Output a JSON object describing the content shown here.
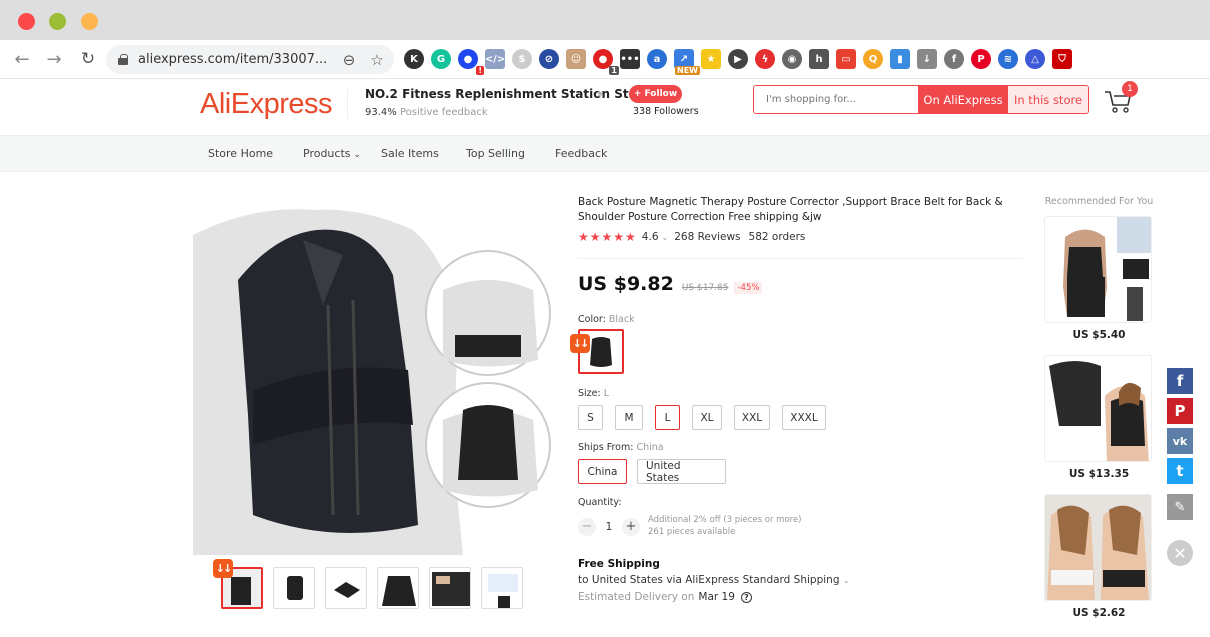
{
  "browser": {
    "url": "aliexpress.com/item/33007...",
    "window_dots": [
      "#fc4a4a",
      "#9bbd36",
      "#ffb54f"
    ],
    "extensions": [
      {
        "name": "k-extension",
        "glyph": "K",
        "color": "#333",
        "badge": ""
      },
      {
        "name": "grammarly",
        "glyph": "G",
        "color": "#15c39a",
        "badge": ""
      },
      {
        "name": "blue-circle-ext",
        "glyph": "●",
        "color": "#2046f0",
        "badge": "!"
      },
      {
        "name": "code-ext",
        "glyph": "</>",
        "color": "#8fa1c4",
        "badge": ""
      },
      {
        "name": "search-dollar-ext",
        "glyph": "$",
        "color": "#ccc",
        "badge": ""
      },
      {
        "name": "block-ext",
        "glyph": "⊘",
        "color": "#2a4ca0",
        "badge": ""
      },
      {
        "name": "face-ext",
        "glyph": "☺",
        "color": "#c9a27b",
        "badge": ""
      },
      {
        "name": "red-ext",
        "glyph": "●",
        "color": "#e12020",
        "badge": "1"
      },
      {
        "name": "dots-ext",
        "glyph": "•••",
        "color": "#333",
        "badge": ""
      },
      {
        "name": "a-ext",
        "glyph": "a",
        "color": "#2a6fd6",
        "badge": ""
      },
      {
        "name": "arrow-ext",
        "glyph": "↗",
        "color": "#3a7de0",
        "badge": "NEW"
      },
      {
        "name": "star-ext",
        "glyph": "★",
        "color": "#f5c518",
        "badge": ""
      },
      {
        "name": "play-ext",
        "glyph": "▶",
        "color": "#444",
        "badge": ""
      },
      {
        "name": "flash-ext",
        "glyph": "ϟ",
        "color": "#e62e2e",
        "badge": ""
      },
      {
        "name": "film-ext",
        "glyph": "◉",
        "color": "#666",
        "badge": ""
      },
      {
        "name": "hubspot-ext",
        "glyph": "h",
        "color": "#555",
        "badge": ""
      },
      {
        "name": "ticket-ext",
        "glyph": "▭",
        "color": "#e8402f",
        "badge": ""
      },
      {
        "name": "orange-search-ext",
        "glyph": "Q",
        "color": "#f5a623",
        "badge": ""
      },
      {
        "name": "chart-ext",
        "glyph": "▮",
        "color": "#3b8be0",
        "badge": ""
      },
      {
        "name": "download-ext",
        "glyph": "↓",
        "color": "#888",
        "badge": ""
      },
      {
        "name": "facebook-ext",
        "glyph": "f",
        "color": "#777",
        "badge": ""
      },
      {
        "name": "pinterest-ext",
        "glyph": "P",
        "color": "#e60023",
        "badge": ""
      },
      {
        "name": "wave-ext",
        "glyph": "≋",
        "color": "#2a6fd6",
        "badge": ""
      },
      {
        "name": "triangle-ext",
        "glyph": "△",
        "color": "#3c5ad6",
        "badge": ""
      },
      {
        "name": "shield-ext",
        "glyph": "⛉",
        "color": "#c00",
        "badge": ""
      }
    ]
  },
  "store": {
    "logo": "AliExpress",
    "name": "NO.2 Fitness Replenishment Station St...",
    "feedback_pct": "93.4%",
    "feedback_label": "Positive feedback",
    "follow_label": "+ Follow",
    "followers": "338 Followers",
    "search_placeholder": "I'm shopping for...",
    "search_on_ali": "On AliExpress",
    "search_in_store": "In this store",
    "cart_count": "1"
  },
  "store_nav": [
    "Store Home",
    "Products",
    "Sale Items",
    "Top Selling",
    "Feedback"
  ],
  "product": {
    "title": "Back Posture Magnetic Therapy Posture Corrector ,Support Brace Belt for Back & Shoulder Posture Correction Free shipping &jw",
    "stars": "★★★★★",
    "rating": "4.6",
    "reviews": "268 Reviews",
    "orders": "582 orders",
    "price": "US $9.82",
    "old_price": "US $17.85",
    "discount": "-45%",
    "color_label": "Color:",
    "color_value": "Black",
    "size_label": "Size:",
    "size_value": "L",
    "sizes": [
      "S",
      "M",
      "L",
      "XL",
      "XXL",
      "XXXL"
    ],
    "selected_size": "L",
    "ships_label": "Ships From:",
    "ships_value": "China",
    "ships_options": [
      "China",
      "United States"
    ],
    "quantity_label": "Quantity:",
    "quantity": "1",
    "qty_note_1": "Additional 2% off (3 pieces or more)",
    "qty_note_2": "261 pieces available",
    "shipping_title": "Free Shipping",
    "shipping_line": "to United States via AliExpress Standard Shipping",
    "delivery_label": "Estimated Delivery on",
    "delivery_date": "Mar 19",
    "thumbnail_count": 6,
    "accent": "#e62e2e"
  },
  "recommended": {
    "title": "Recommended For You",
    "items": [
      {
        "price": "US $5.40"
      },
      {
        "price": "US $13.35"
      },
      {
        "price": "US $2.62"
      }
    ]
  },
  "social": [
    {
      "name": "facebook",
      "glyph": "f",
      "color": "#3b5998"
    },
    {
      "name": "pinterest",
      "glyph": "P",
      "color": "#cb2027"
    },
    {
      "name": "vk",
      "glyph": "vk",
      "color": "#5b7fa6"
    },
    {
      "name": "twitter",
      "glyph": "t",
      "color": "#1da1f2"
    },
    {
      "name": "edit",
      "glyph": "✎",
      "color": "#999"
    }
  ]
}
